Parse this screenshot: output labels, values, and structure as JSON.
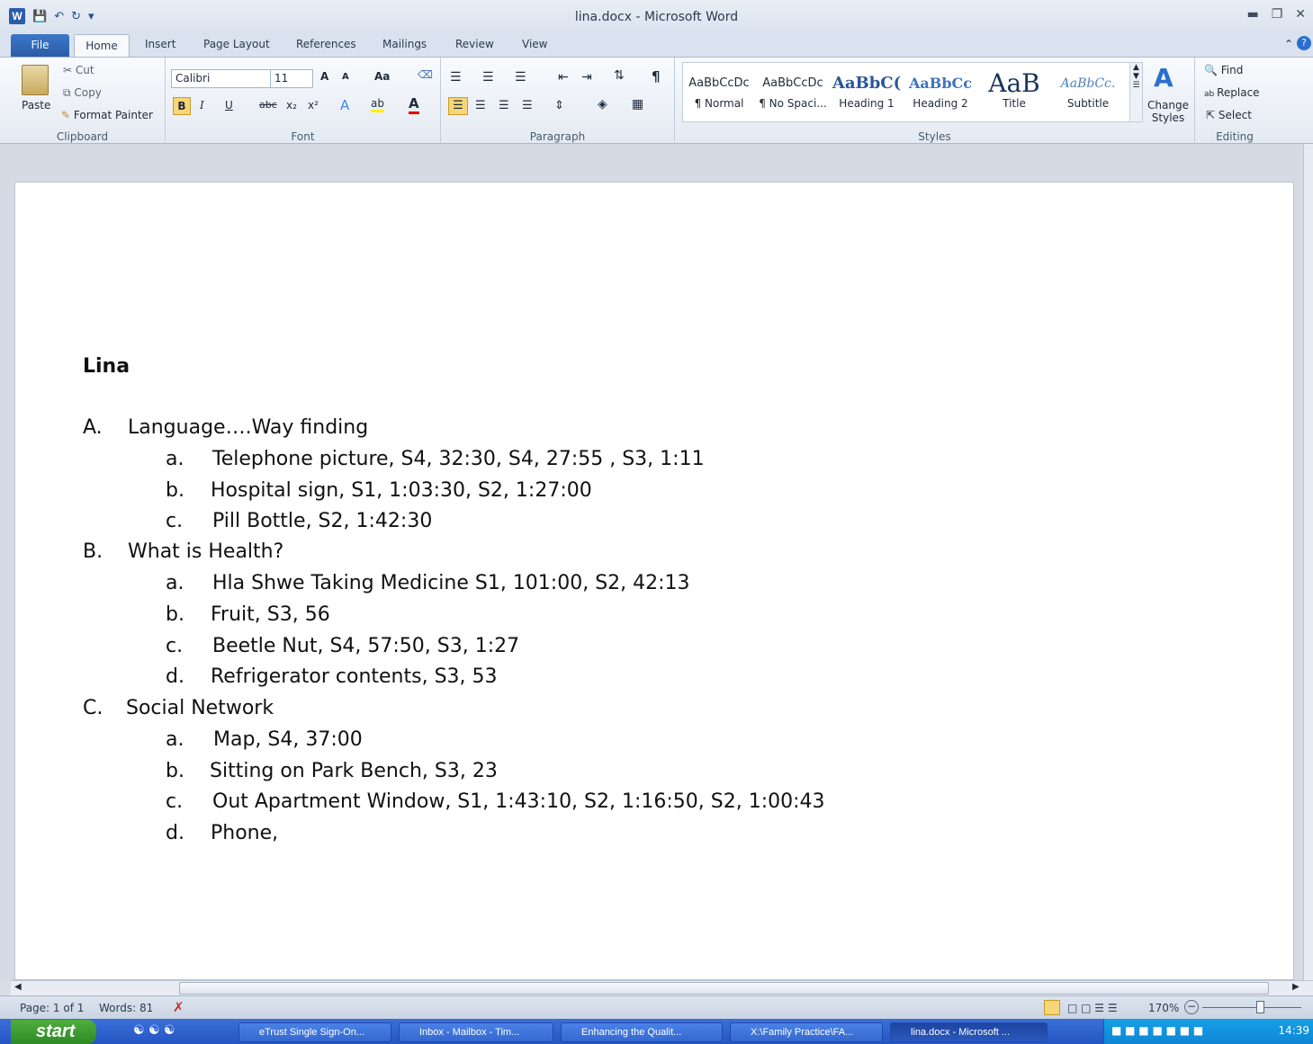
{
  "window": {
    "title": "lina.docx - Microsoft Word"
  },
  "tabs": [
    "File",
    "Home",
    "Insert",
    "Page Layout",
    "References",
    "Mailings",
    "Review",
    "View"
  ],
  "clipboard": {
    "paste": "Paste",
    "cut": "Cut",
    "copy": "Copy",
    "format_painter": "Format Painter",
    "label": "Clipboard"
  },
  "font": {
    "name": "Calibri",
    "size": "11",
    "label": "Font",
    "bold": "B",
    "italic": "I",
    "underline": "U",
    "strike": "abc",
    "sub": "x₂",
    "sup": "x²",
    "grow": "A",
    "shrink": "A",
    "case": "Aa"
  },
  "paragraph": {
    "label": "Paragraph"
  },
  "styles": {
    "label": "Styles",
    "change": "Change Styles",
    "items": [
      {
        "preview": "AaBbCcDc",
        "name": "¶ Normal"
      },
      {
        "preview": "AaBbCcDc",
        "name": "¶ No Spaci..."
      },
      {
        "preview": "AaBbC(",
        "name": "Heading 1"
      },
      {
        "preview": "AaBbCc",
        "name": "Heading 2"
      },
      {
        "preview": "AaB",
        "name": "Title"
      },
      {
        "preview": "AaBbCc.",
        "name": "Subtitle"
      }
    ]
  },
  "editing": {
    "label": "Editing",
    "find": "Find",
    "replace": "Replace",
    "select": "Select"
  },
  "document": {
    "heading": "Lina",
    "sections": [
      {
        "marker": "A.",
        "title": "Language….Way finding",
        "items": [
          {
            "marker": "a.",
            "text": "Telephone picture, S4, 32:30, S4, 27:55 , S3, 1:11"
          },
          {
            "marker": "b.",
            "text": "Hospital sign, S1, 1:03:30, S2, 1:27:00"
          },
          {
            "marker": "c.",
            "text": "Pill Bottle, S2, 1:42:30"
          }
        ]
      },
      {
        "marker": "B.",
        "title": "What is Health?",
        "items": [
          {
            "marker": "a.",
            "text": "Hla Shwe Taking Medicine S1, 101:00, S2, 42:13"
          },
          {
            "marker": "b.",
            "text": "Fruit, S3, 56"
          },
          {
            "marker": "c.",
            "text": "Beetle Nut, S4, 57:50, S3, 1:27"
          },
          {
            "marker": "d.",
            "text": "Refrigerator contents, S3, 53"
          }
        ]
      },
      {
        "marker": "C.",
        "title": "Social Network",
        "items": [
          {
            "marker": "a.",
            "text": "Map, S4, 37:00"
          },
          {
            "marker": "b.",
            "text": "Sitting on Park Bench, S3, 23"
          },
          {
            "marker": "c.",
            "text": "Out Apartment Window, S1, 1:43:10, S2, 1:16:50, S2, 1:00:43"
          },
          {
            "marker": "d.",
            "text": "Phone,"
          }
        ]
      }
    ]
  },
  "status": {
    "page": "Page: 1 of 1",
    "words": "Words: 81",
    "zoom": "170%"
  },
  "taskbar": {
    "start": "start",
    "clock": "14:39",
    "windows": [
      "eTrust Single Sign-On...",
      "Inbox - Mailbox - Tim...",
      "Enhancing the Qualit...",
      "X:\\Family Practice\\FA...",
      "lina.docx - Microsoft ..."
    ]
  }
}
